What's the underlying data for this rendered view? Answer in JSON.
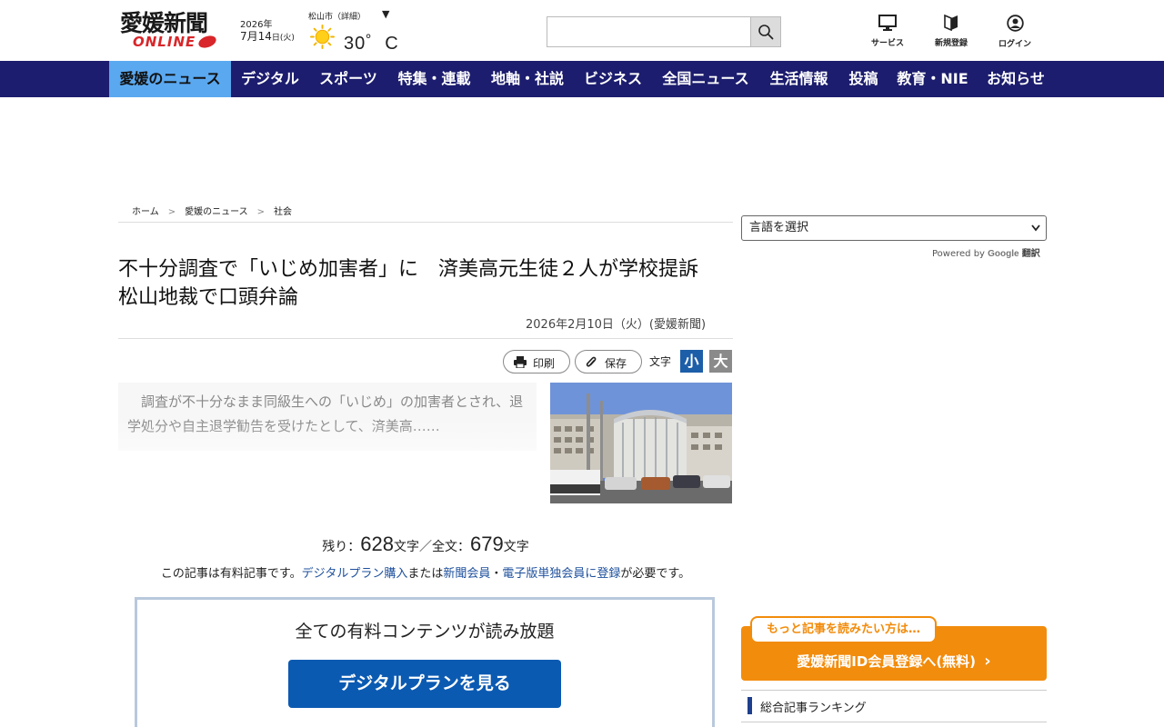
{
  "header": {
    "logo_main": "愛媛新聞",
    "logo_sub": "ONLINE",
    "date_year": "2026年",
    "date_md": "7月14",
    "date_rest": "日(火)",
    "weather_location": "松山市（詳細）",
    "weather_toggle": "▼",
    "weather_icon": "sun-icon",
    "temperature": "30゜C",
    "search_placeholder": "",
    "nav_service": "サービス",
    "nav_register": "新規登録",
    "nav_login": "ログイン"
  },
  "nav": {
    "items": [
      {
        "label": "愛媛のニュース",
        "active": true
      },
      {
        "label": "デジタル"
      },
      {
        "label": "スポーツ"
      },
      {
        "label": "特集・連載"
      },
      {
        "label": "地軸・社説"
      },
      {
        "label": "ビジネス"
      },
      {
        "label": "全国ニュース"
      },
      {
        "label": "生活情報"
      },
      {
        "label": "投稿"
      },
      {
        "label": "教育・NIE"
      },
      {
        "label": "お知らせ"
      }
    ],
    "colors": {
      "bar": "#1c1d6e",
      "active": "#5aa8f0"
    }
  },
  "breadcrumb": {
    "items": [
      "ホーム",
      "愛媛のニュース",
      "社会"
    ],
    "sep": ">"
  },
  "article": {
    "title": "不十分調査で「いじめ加害者」に　済美高元生徒２人が学校提訴　松山地裁で口頭弁論",
    "date": "2026年2月10日（火）(愛媛新聞)",
    "print_label": "印刷",
    "save_label": "保存",
    "font_size_label": "文字",
    "font_small": "小",
    "font_large": "大",
    "excerpt": "　調査が不十分なまま同級生への「いじめ」の加害者とされ、退学処分や自主退学勧告を受けたとして、済美高……",
    "remaining_prefix": "残り：",
    "remaining_count": "628",
    "remaining_mid": "文字／全文：",
    "total_count": "679",
    "remaining_suffix": "文字",
    "notice_prefix": "この記事は有料記事です。",
    "notice_link1": "デジタルプラン購入",
    "notice_mid": "または",
    "notice_link2": "新聞会員",
    "notice_dot": "・",
    "notice_link3": "電子版単独会員に登録",
    "notice_suffix": "が必要です。",
    "plan_title": "全ての有料コンテンツが読み放題",
    "plan_button": "デジタルプランを見る"
  },
  "sidebar": {
    "language_select": "言語を選択",
    "powered_by": "Powered by",
    "google": "Google",
    "translate": "翻訳",
    "register_tag": "もっと記事を読みたい方は…",
    "register_label": "愛媛新聞ID会員登録へ(無料)",
    "register_arrow": "›",
    "ranking_title": "総合記事ランキング"
  },
  "colors": {
    "brand_red": "#d8262a",
    "link_blue": "#1d4f9c",
    "plan_button": "#0b5ab2",
    "register_orange": "#f28c0c",
    "font_small_bg": "#1d5ea8",
    "font_large_bg": "#8a8a8a"
  }
}
